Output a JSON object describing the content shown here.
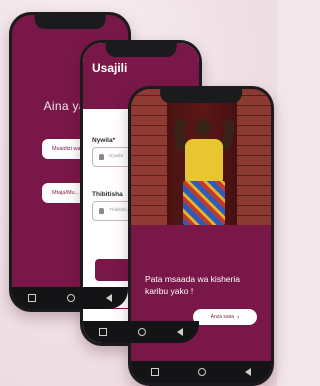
{
  "colors": {
    "brand": "#7a1749",
    "page_background": "#f3e6ea"
  },
  "phone1": {
    "title": "Aina ya u",
    "options": [
      "Msaidizi wa...",
      "Mtaja/Mu..."
    ]
  },
  "phone2": {
    "header_title": "Usajili",
    "field1_label": "Nywila*",
    "field1_placeholder": "Nywila",
    "field2_label": "Thibitisha",
    "field2_placeholder": "Thibitish..."
  },
  "phone3": {
    "tagline": "Pata msaada wa kisheria karibu yako !",
    "cta_label": "Anza sasa",
    "cta_icon": "chevron-right-icon"
  }
}
